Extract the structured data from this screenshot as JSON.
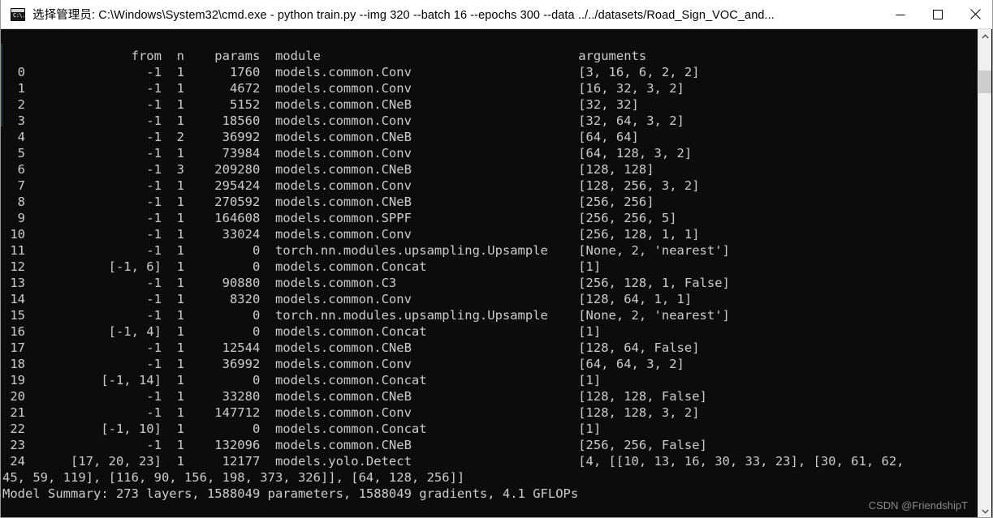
{
  "window": {
    "title": "选择管理员: C:\\Windows\\System32\\cmd.exe - python  train.py --img 320 --batch 16 --epochs 300 --data ../../datasets/Road_Sign_VOC_and...",
    "icon_label": "C:\\.",
    "minimize_label": "最小化",
    "maximize_label": "最大化",
    "close_label": "关闭"
  },
  "colors": {
    "console_bg": "#0c0c0c",
    "console_fg": "#cccccc",
    "titlebar_bg": "#ffffff",
    "scrollbar_track": "#f0f0f0",
    "scrollbar_thumb": "#cdcdcd"
  },
  "terminal": {
    "columns": [
      "from",
      "n",
      "params",
      "module",
      "arguments"
    ],
    "header_line": "                 from  n    params  module                                  arguments",
    "rows": [
      {
        "idx": "0",
        "from": "-1",
        "n": "1",
        "params": "1760",
        "module": "models.common.Conv",
        "arguments": "[3, 16, 6, 2, 2]"
      },
      {
        "idx": "1",
        "from": "-1",
        "n": "1",
        "params": "4672",
        "module": "models.common.Conv",
        "arguments": "[16, 32, 3, 2]"
      },
      {
        "idx": "2",
        "from": "-1",
        "n": "1",
        "params": "5152",
        "module": "models.common.CNeB",
        "arguments": "[32, 32]"
      },
      {
        "idx": "3",
        "from": "-1",
        "n": "1",
        "params": "18560",
        "module": "models.common.Conv",
        "arguments": "[32, 64, 3, 2]"
      },
      {
        "idx": "4",
        "from": "-1",
        "n": "2",
        "params": "36992",
        "module": "models.common.CNeB",
        "arguments": "[64, 64]"
      },
      {
        "idx": "5",
        "from": "-1",
        "n": "1",
        "params": "73984",
        "module": "models.common.Conv",
        "arguments": "[64, 128, 3, 2]"
      },
      {
        "idx": "6",
        "from": "-1",
        "n": "3",
        "params": "209280",
        "module": "models.common.CNeB",
        "arguments": "[128, 128]"
      },
      {
        "idx": "7",
        "from": "-1",
        "n": "1",
        "params": "295424",
        "module": "models.common.Conv",
        "arguments": "[128, 256, 3, 2]"
      },
      {
        "idx": "8",
        "from": "-1",
        "n": "1",
        "params": "270592",
        "module": "models.common.CNeB",
        "arguments": "[256, 256]"
      },
      {
        "idx": "9",
        "from": "-1",
        "n": "1",
        "params": "164608",
        "module": "models.common.SPPF",
        "arguments": "[256, 256, 5]"
      },
      {
        "idx": "10",
        "from": "-1",
        "n": "1",
        "params": "33024",
        "module": "models.common.Conv",
        "arguments": "[256, 128, 1, 1]"
      },
      {
        "idx": "11",
        "from": "-1",
        "n": "1",
        "params": "0",
        "module": "torch.nn.modules.upsampling.Upsample",
        "arguments": "[None, 2, 'nearest']"
      },
      {
        "idx": "12",
        "from": "[-1, 6]",
        "n": "1",
        "params": "0",
        "module": "models.common.Concat",
        "arguments": "[1]"
      },
      {
        "idx": "13",
        "from": "-1",
        "n": "1",
        "params": "90880",
        "module": "models.common.C3",
        "arguments": "[256, 128, 1, False]"
      },
      {
        "idx": "14",
        "from": "-1",
        "n": "1",
        "params": "8320",
        "module": "models.common.Conv",
        "arguments": "[128, 64, 1, 1]"
      },
      {
        "idx": "15",
        "from": "-1",
        "n": "1",
        "params": "0",
        "module": "torch.nn.modules.upsampling.Upsample",
        "arguments": "[None, 2, 'nearest']"
      },
      {
        "idx": "16",
        "from": "[-1, 4]",
        "n": "1",
        "params": "0",
        "module": "models.common.Concat",
        "arguments": "[1]"
      },
      {
        "idx": "17",
        "from": "-1",
        "n": "1",
        "params": "12544",
        "module": "models.common.CNeB",
        "arguments": "[128, 64, False]"
      },
      {
        "idx": "18",
        "from": "-1",
        "n": "1",
        "params": "36992",
        "module": "models.common.Conv",
        "arguments": "[64, 64, 3, 2]"
      },
      {
        "idx": "19",
        "from": "[-1, 14]",
        "n": "1",
        "params": "0",
        "module": "models.common.Concat",
        "arguments": "[1]"
      },
      {
        "idx": "20",
        "from": "-1",
        "n": "1",
        "params": "33280",
        "module": "models.common.CNeB",
        "arguments": "[128, 128, False]"
      },
      {
        "idx": "21",
        "from": "-1",
        "n": "1",
        "params": "147712",
        "module": "models.common.Conv",
        "arguments": "[128, 128, 3, 2]"
      },
      {
        "idx": "22",
        "from": "[-1, 10]",
        "n": "1",
        "params": "0",
        "module": "models.common.Concat",
        "arguments": "[1]"
      },
      {
        "idx": "23",
        "from": "-1",
        "n": "1",
        "params": "132096",
        "module": "models.common.CNeB",
        "arguments": "[256, 256, False]"
      },
      {
        "idx": "24",
        "from": "[17, 20, 23]",
        "n": "1",
        "params": "12177",
        "module": "models.yolo.Detect",
        "arguments": "[4, [[10, 13, 16, 30, 33, 23], [30, 61, 62, 45, 59, 119], [116, 90, 156, 198, 373, 326]], [64, 128, 256]]"
      }
    ],
    "body_text": "                 from  n    params  module                                  arguments\n  0                -1  1      1760  models.common.Conv                      [3, 16, 6, 2, 2]\n  1                -1  1      4672  models.common.Conv                      [16, 32, 3, 2]\n  2                -1  1      5152  models.common.CNeB                      [32, 32]\n  3                -1  1     18560  models.common.Conv                      [32, 64, 3, 2]\n  4                -1  2     36992  models.common.CNeB                      [64, 64]\n  5                -1  1     73984  models.common.Conv                      [64, 128, 3, 2]\n  6                -1  3    209280  models.common.CNeB                      [128, 128]\n  7                -1  1    295424  models.common.Conv                      [128, 256, 3, 2]\n  8                -1  1    270592  models.common.CNeB                      [256, 256]\n  9                -1  1    164608  models.common.SPPF                      [256, 256, 5]\n 10                -1  1     33024  models.common.Conv                      [256, 128, 1, 1]\n 11                -1  1         0  torch.nn.modules.upsampling.Upsample    [None, 2, 'nearest']\n 12           [-1, 6]  1         0  models.common.Concat                    [1]\n 13                -1  1     90880  models.common.C3                        [256, 128, 1, False]\n 14                -1  1      8320  models.common.Conv                      [128, 64, 1, 1]\n 15                -1  1         0  torch.nn.modules.upsampling.Upsample    [None, 2, 'nearest']\n 16           [-1, 4]  1         0  models.common.Concat                    [1]\n 17                -1  1     12544  models.common.CNeB                      [128, 64, False]\n 18                -1  1     36992  models.common.Conv                      [64, 64, 3, 2]\n 19          [-1, 14]  1         0  models.common.Concat                    [1]\n 20                -1  1     33280  models.common.CNeB                      [128, 128, False]\n 21                -1  1    147712  models.common.Conv                      [128, 128, 3, 2]\n 22          [-1, 10]  1         0  models.common.Concat                    [1]\n 23                -1  1    132096  models.common.CNeB                      [256, 256, False]\n 24      [17, 20, 23]  1     12177  models.yolo.Detect                      [4, [[10, 13, 16, 30, 33, 23], [30, 61, 62,\n45, 59, 119], [116, 90, 156, 198, 373, 326]], [64, 128, 256]]\nModel Summary: 273 layers, 1588049 parameters, 1588049 gradients, 4.1 GFLOPs",
    "summary": {
      "label": "Model Summary:",
      "layers": "273 layers",
      "parameters": "1588049 parameters",
      "gradients": "1588049 gradients",
      "gflops": "4.1 GFLOPs",
      "line": "Model Summary: 273 layers, 1588049 parameters, 1588049 gradients, 4.1 GFLOPs"
    }
  },
  "watermark": {
    "text": "CSDN @FriendshipT"
  },
  "scrollbar": {
    "up_arrow": "scroll-up",
    "down_arrow": "scroll-down",
    "thumb": "scroll-thumb"
  }
}
